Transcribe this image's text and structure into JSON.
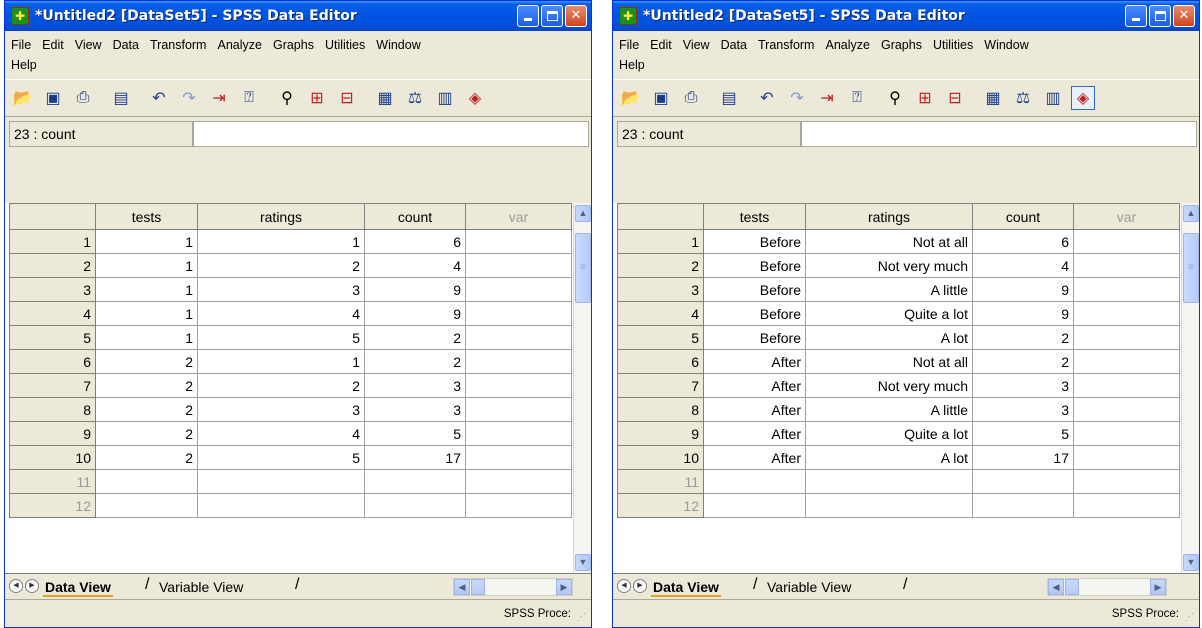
{
  "left": {
    "title": "*Untitled2 [DataSet5] - SPSS Data Editor",
    "menu_row1": [
      "File",
      "Edit",
      "View",
      "Data",
      "Transform",
      "Analyze",
      "Graphs",
      "Utilities",
      "Window"
    ],
    "menu_row2": [
      "Help"
    ],
    "cell_ref": "23 : count",
    "columns": [
      "tests",
      "ratings",
      "count",
      "var"
    ],
    "rows": [
      {
        "n": "1",
        "tests": "1",
        "ratings": "1",
        "count": "6"
      },
      {
        "n": "2",
        "tests": "1",
        "ratings": "2",
        "count": "4"
      },
      {
        "n": "3",
        "tests": "1",
        "ratings": "3",
        "count": "9"
      },
      {
        "n": "4",
        "tests": "1",
        "ratings": "4",
        "count": "9"
      },
      {
        "n": "5",
        "tests": "1",
        "ratings": "5",
        "count": "2"
      },
      {
        "n": "6",
        "tests": "2",
        "ratings": "1",
        "count": "2"
      },
      {
        "n": "7",
        "tests": "2",
        "ratings": "2",
        "count": "3"
      },
      {
        "n": "8",
        "tests": "2",
        "ratings": "3",
        "count": "3"
      },
      {
        "n": "9",
        "tests": "2",
        "ratings": "4",
        "count": "5"
      },
      {
        "n": "10",
        "tests": "2",
        "ratings": "5",
        "count": "17"
      },
      {
        "n": "11",
        "tests": "",
        "ratings": "",
        "count": ""
      },
      {
        "n": "12",
        "tests": "",
        "ratings": "",
        "count": ""
      }
    ],
    "tabs": {
      "data_view": "Data View",
      "variable_view": "Variable View"
    },
    "status": "SPSS Proce:"
  },
  "right": {
    "title": "*Untitled2 [DataSet5] - SPSS Data Editor",
    "menu_row1": [
      "File",
      "Edit",
      "View",
      "Data",
      "Transform",
      "Analyze",
      "Graphs",
      "Utilities",
      "Window"
    ],
    "menu_row2": [
      "Help"
    ],
    "cell_ref": "23 : count",
    "columns": [
      "tests",
      "ratings",
      "count",
      "var"
    ],
    "rows": [
      {
        "n": "1",
        "tests": "Before",
        "ratings": "Not at all",
        "count": "6"
      },
      {
        "n": "2",
        "tests": "Before",
        "ratings": "Not very much",
        "count": "4"
      },
      {
        "n": "3",
        "tests": "Before",
        "ratings": "A little",
        "count": "9"
      },
      {
        "n": "4",
        "tests": "Before",
        "ratings": "Quite a lot",
        "count": "9"
      },
      {
        "n": "5",
        "tests": "Before",
        "ratings": "A lot",
        "count": "2"
      },
      {
        "n": "6",
        "tests": "After",
        "ratings": "Not at all",
        "count": "2"
      },
      {
        "n": "7",
        "tests": "After",
        "ratings": "Not very much",
        "count": "3"
      },
      {
        "n": "8",
        "tests": "After",
        "ratings": "A little",
        "count": "3"
      },
      {
        "n": "9",
        "tests": "After",
        "ratings": "Quite a lot",
        "count": "5"
      },
      {
        "n": "10",
        "tests": "After",
        "ratings": "A lot",
        "count": "17"
      },
      {
        "n": "11",
        "tests": "",
        "ratings": "",
        "count": ""
      },
      {
        "n": "12",
        "tests": "",
        "ratings": "",
        "count": ""
      }
    ],
    "tabs": {
      "data_view": "Data View",
      "variable_view": "Variable View"
    },
    "status": "SPSS Proce:"
  },
  "icons": [
    "open-icon",
    "save-icon",
    "print-icon",
    "dialog-recall-icon",
    "undo-icon",
    "redo-icon",
    "goto-case-icon",
    "variables-icon",
    "find-icon",
    "insert-cases-icon",
    "insert-variable-icon",
    "split-file-icon",
    "weight-cases-icon",
    "select-cases-icon",
    "value-labels-icon"
  ]
}
